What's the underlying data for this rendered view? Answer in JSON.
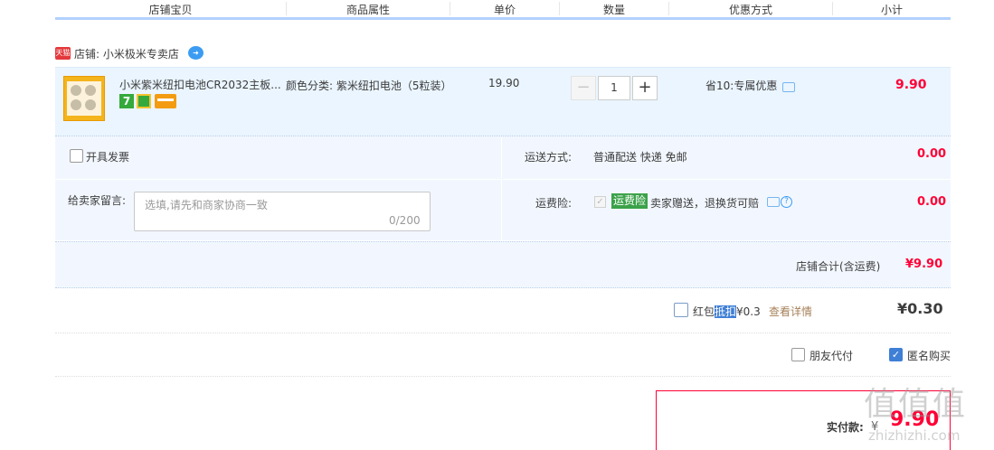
{
  "table_header": {
    "columns": [
      "店铺宝贝",
      "商品属性",
      "单价",
      "数量",
      "优惠方式",
      "小计"
    ]
  },
  "shop": {
    "logo_text": "天猫",
    "label": "店铺: 小米极米专卖店"
  },
  "item": {
    "title": "小米紫米纽扣电池CR2032主板...",
    "badge_seven": "7",
    "attribute": "颜色分类: 紫米纽扣电池（5粒装）",
    "unit_price": "19.90",
    "quantity": "1",
    "minus_label": "−",
    "plus_label": "+",
    "discount": "省10:专属优惠",
    "subtotal": "9.90"
  },
  "options": {
    "invoice_label": "开具发票",
    "remark_label": "给卖家留言:",
    "remark_placeholder": "选填,请先和商家协商一致",
    "remark_count": "0/200",
    "shipping_label": "运送方式:",
    "shipping_value": "普通配送 快递 免邮",
    "shipping_amount": "0.00",
    "insurance_label": "运费险:",
    "insurance_tag": "运费险",
    "insurance_text": "卖家赠送，退换货可赔",
    "insurance_amount": "0.00"
  },
  "store_total": {
    "label": "店铺合计(含运费)",
    "value": "¥9.90"
  },
  "red_packet": {
    "label_pre": "红包",
    "label_hl": "抵扣",
    "label_post": "¥0.3",
    "details_link": "查看详情",
    "amount": "¥0.30"
  },
  "extra_options": {
    "friend_pay": "朋友代付",
    "anonymous": "匿名购买"
  },
  "payment": {
    "label": "实付款:",
    "currency": "¥",
    "value": "9.90"
  },
  "watermark": {
    "glyphs": "值值值",
    "site": "zhizhizhi.com"
  },
  "colors": {
    "price_red": "#ff0036",
    "row_blue": "#eaf5ff",
    "panel_blue": "#f2f7ff",
    "header_rule": "#b2d1ff",
    "check_blue": "#3f7fd6"
  }
}
